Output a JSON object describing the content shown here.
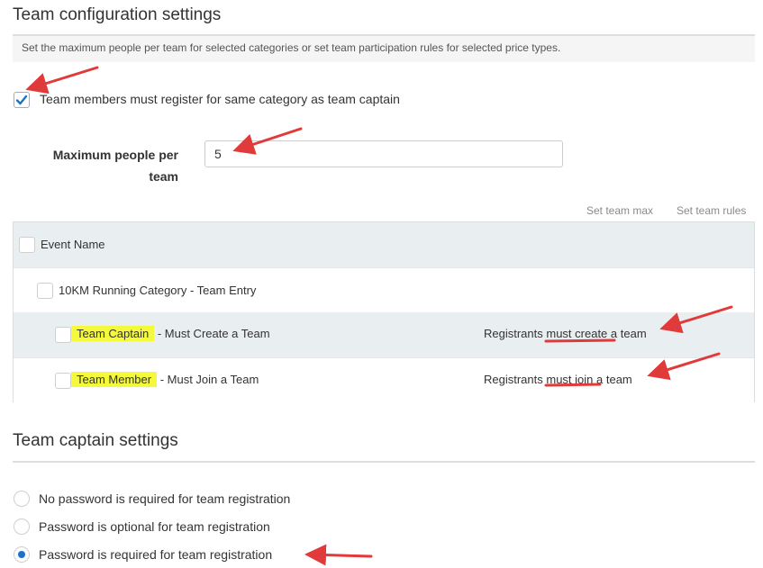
{
  "team_config": {
    "title": "Team configuration settings",
    "description": "Set the maximum people per team for selected categories or set team participation rules for selected price types.",
    "same_category_label": "Team members must register for same category as team captain",
    "same_category_checked": true,
    "max_people_label_line1": "Maximum people per",
    "max_people_label_line2": "team",
    "max_people_value": "5",
    "set_team_max": "Set team max",
    "set_team_rules": "Set team rules"
  },
  "table": {
    "header": "Event Name",
    "category": "10KM Running Category - Team Entry",
    "rows": [
      {
        "highlight": "Team Captain",
        "rest": " - Must Create a Team",
        "rule_prefix": "Registrants ",
        "rule_emph": "must create",
        "rule_suffix": " a team"
      },
      {
        "highlight": "Team Member",
        "rest": " - Must Join a Team",
        "rule_prefix": "Registrants ",
        "rule_emph": "must join",
        "rule_suffix": " a team"
      }
    ]
  },
  "captain": {
    "title": "Team captain settings",
    "options": [
      "No password is required for team registration",
      "Password is optional for team registration",
      "Password is required for team registration"
    ],
    "selected_index": 2
  },
  "colors": {
    "accent": "#1a73c9",
    "annotation": "#e03a3a",
    "highlight": "#f4f93b"
  }
}
